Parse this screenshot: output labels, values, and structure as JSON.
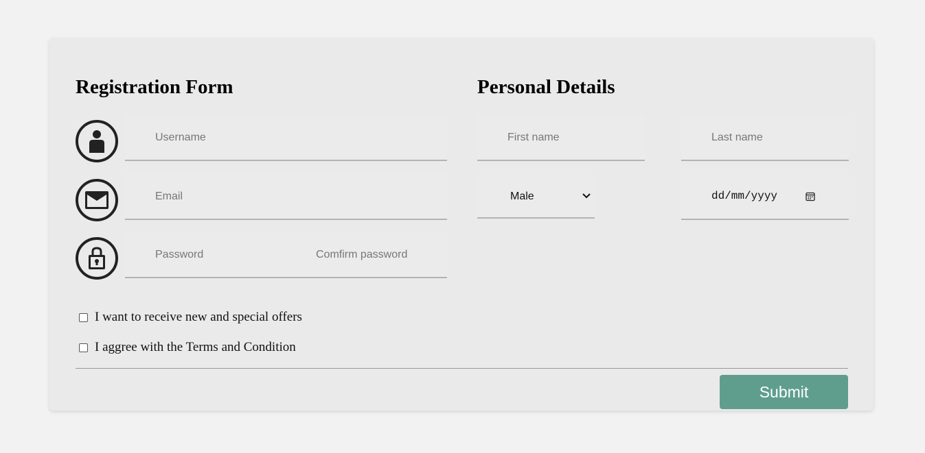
{
  "registration": {
    "title": "Registration Form",
    "username_placeholder": "Username",
    "email_placeholder": "Email",
    "password_placeholder": "Password",
    "confirm_password_placeholder": "Comfirm password",
    "icons": [
      "user-icon",
      "envelope-icon",
      "lock-icon"
    ]
  },
  "personal": {
    "title": "Personal Details",
    "first_name_placeholder": "First name",
    "last_name_placeholder": "Last name",
    "gender_selected": "Male",
    "date_placeholder": "dd/mm/yyyy"
  },
  "checkboxes": {
    "offers_label": "I want to receive new and special offers",
    "offers_checked": false,
    "terms_label": "I aggree with the Terms and Condition",
    "terms_checked": false
  },
  "submit_label": "Submit",
  "colors": {
    "background": "#f2f2f2",
    "card": "#eaeaea",
    "accent": "#5f9e8d",
    "icon": "#222222"
  }
}
